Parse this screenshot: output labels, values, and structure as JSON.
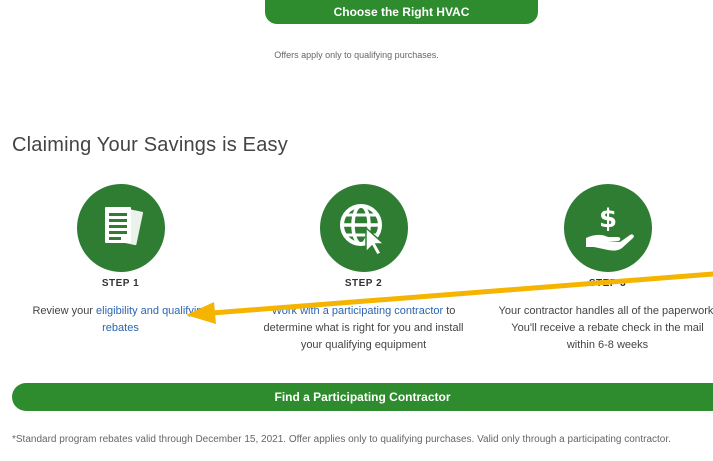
{
  "top_button": {
    "label": "Choose the Right HVAC"
  },
  "offers_note": "Offers apply only to qualifying purchases.",
  "section": {
    "title": "Claiming Your Savings is Easy"
  },
  "steps": [
    {
      "label": "STEP 1",
      "icon": "document-icon",
      "text_before": "Review your ",
      "link_text": "eligibility and qualifying",
      "text_after_line": "rebates"
    },
    {
      "label": "STEP 2",
      "icon": "globe-cursor-icon",
      "link_text": "Work with a participating contractor",
      "text_after": " to determine what is right for you and install your qualifying equipment"
    },
    {
      "label": "STEP 3",
      "icon": "hand-dollar-icon",
      "text": "Your contractor handles all of the paperwork. You'll receive a rebate check in the mail within 6-8 weeks"
    }
  ],
  "bottom_button": {
    "label": "Find a Participating Contractor"
  },
  "disclaimer": "*Standard program rebates valid through December 15, 2021. Offer applies only to qualifying purchases. Valid only through a participating contractor.",
  "colors": {
    "brand_green": "#2e8b2e",
    "icon_green": "#2e7d32",
    "link_blue": "#2a66b0",
    "arrow_yellow": "#f5b400"
  }
}
